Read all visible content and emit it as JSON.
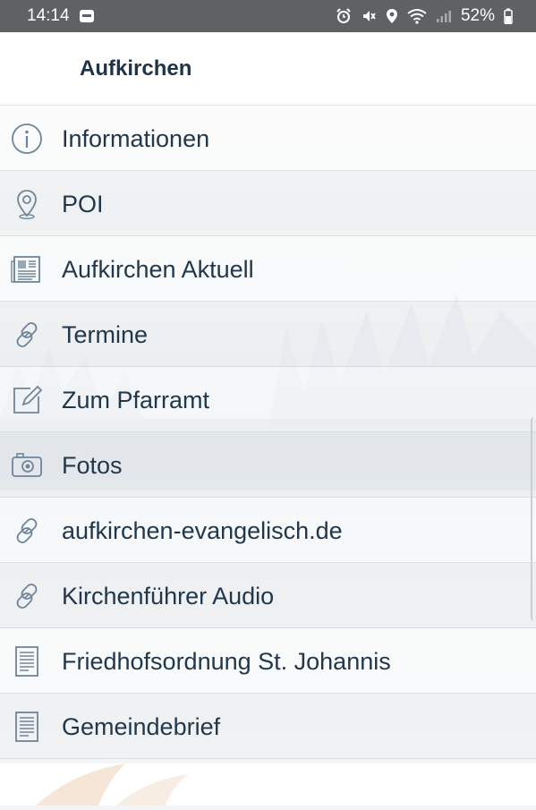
{
  "statusbar": {
    "time": "14:14",
    "battery": "52%"
  },
  "header": {
    "title": "Aufkirchen"
  },
  "menu": {
    "items": [
      {
        "label": "Informationen",
        "icon": "info-icon"
      },
      {
        "label": "POI",
        "icon": "location-pin-icon"
      },
      {
        "label": "Aufkirchen Aktuell",
        "icon": "newspaper-icon"
      },
      {
        "label": "Termine",
        "icon": "link-icon"
      },
      {
        "label": "Zum Pfarramt",
        "icon": "edit-icon"
      },
      {
        "label": "Fotos",
        "icon": "camera-icon"
      },
      {
        "label": "aufkirchen-evangelisch.de",
        "icon": "link-icon"
      },
      {
        "label": "Kirchenführer Audio",
        "icon": "link-icon"
      },
      {
        "label": "Friedhofsordnung St. Johannis",
        "icon": "document-icon"
      },
      {
        "label": "Gemeindebrief",
        "icon": "document-icon"
      }
    ]
  },
  "colors": {
    "statusbar": "#5f6265",
    "text": "#21384c",
    "icon": "#6f859a"
  }
}
